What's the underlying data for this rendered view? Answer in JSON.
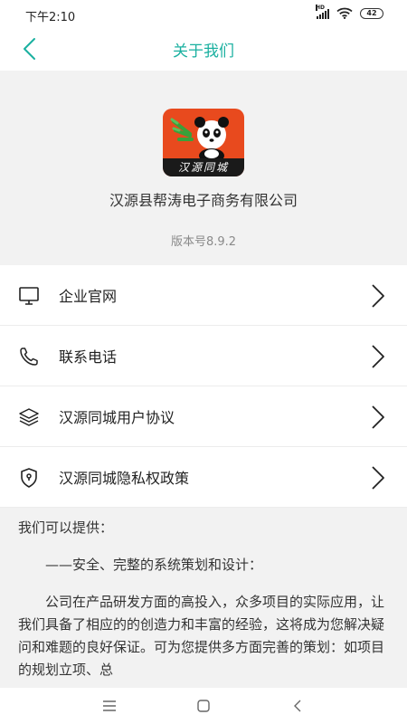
{
  "status_bar": {
    "time": "下午2:10",
    "signal_label": "HD",
    "battery": "42",
    "icons": [
      "signal-icon",
      "wifi-icon",
      "battery-icon"
    ]
  },
  "nav": {
    "title": "关于我们",
    "back_icon": "chevron-left-icon",
    "accent_color": "#1ab0a0"
  },
  "app": {
    "logo_text": "汉源同城",
    "company": "汉源县帮涛电子商务有限公司",
    "version": "版本号8.9.2"
  },
  "menu": {
    "items": [
      {
        "label": "企业官网",
        "icon": "monitor-icon"
      },
      {
        "label": "联系电话",
        "icon": "phone-icon"
      },
      {
        "label": "汉源同城用户协议",
        "icon": "layers-icon"
      },
      {
        "label": "汉源同城隐私权政策",
        "icon": "shield-icon"
      }
    ]
  },
  "info": {
    "heading": "我们可以提供：",
    "line1": "——安全、完整的系统策划和设计：",
    "para": "公司在产品研发方面的高投入，众多项目的实际应用，让我们具备了相应的的创造力和丰富的经验，这将成为您解决疑问和难题的良好保证。可为您提供多方面完善的策划：如项目的规划立项、总"
  },
  "system_nav": {
    "buttons": [
      "menu-icon",
      "home-icon",
      "back-icon"
    ]
  }
}
